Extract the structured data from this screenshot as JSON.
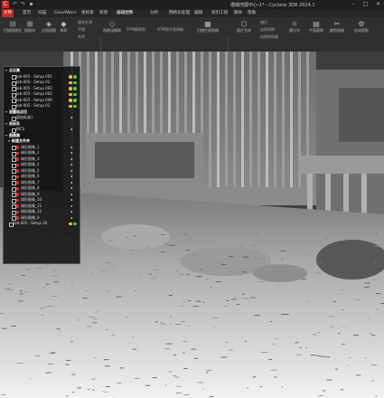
{
  "window": {
    "logo": "C",
    "title": "珊瑚湾展中心-1* - Cyclone 3DR 2024.1",
    "controls": [
      "–",
      "□",
      "✕"
    ]
  },
  "menu_tabs": [
    {
      "label": "文件",
      "kind": "file"
    },
    {
      "label": "首页"
    },
    {
      "label": "扫描"
    },
    {
      "label": "CloudWorx"
    },
    {
      "label": "坐标系"
    },
    {
      "label": "修改"
    },
    {
      "label": "编辑图像",
      "kind": "active"
    },
    {
      "label": "分析"
    },
    {
      "label": "网格化处理"
    },
    {
      "label": "编辑"
    },
    {
      "label": "指引工程"
    },
    {
      "label": "脚本"
    },
    {
      "label": "帮助"
    }
  ],
  "ribbon": {
    "groups": [
      "网格化",
      "平面图",
      "网格化处理",
      "自动提取"
    ],
    "buttons": [
      "扫描网格化",
      "网格化",
      "点到网格",
      "体积",
      "网格化精简",
      "扫描生成网格",
      "面片生成",
      "网格化",
      "连接",
      "细化",
      "横与光",
      "平面网格",
      "裁剪网格",
      "自动提取"
    ],
    "small_items": [
      "填充孔洞",
      "平滑",
      "合并",
      "DTM精简到",
      "DTM到平面网格",
      "遍历",
      "连续间隙",
      "连接到轮廓",
      "挖"
    ]
  },
  "tree": {
    "sections": {
      "point_clouds": "点云集",
      "locations": "测量站点位",
      "coordinate_systems": "坐标系",
      "images": "图像集",
      "images_sub": "新建文件夹"
    },
    "point_clouds": [
      "Job-005 - Setup 001",
      "Job-005 - Setup 02",
      "Job-005 - Setup 002",
      "Job-005 - Setup 002",
      "Job-005 - Setup 049",
      "Job-005 - Setup 03"
    ],
    "locations": [
      "测站标准1"
    ],
    "coordinate_systems": [
      "WCS"
    ],
    "images": [
      "球形图像_1",
      "球形图像_2",
      "球形图像_3",
      "球形图像_4",
      "球形图像_5",
      "球形图像_6",
      "球形图像_7",
      "球形图像_8",
      "球形图像_9",
      "球形图像_10",
      "球形图像_11",
      "球形图像_12",
      "球形图像_0"
    ],
    "last_item": "Job-005 - Setup 30"
  },
  "colors": {
    "accent": "#c92a2a",
    "title_bg": "#1f1f1f",
    "ribbon_bg": "#2f2f2f",
    "panel_bg": "#121212",
    "yellow_dot": "#f2c230",
    "green_dot": "#4cd137"
  },
  "icons": [
    "logo-icon",
    "undo-icon",
    "redo-icon",
    "save-icon",
    "minimize-icon",
    "maximize-icon",
    "close-icon",
    "expand-icon",
    "checkbox-icon",
    "image-icon",
    "pin-icon"
  ]
}
